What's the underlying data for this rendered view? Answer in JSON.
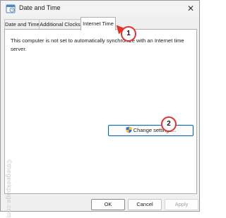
{
  "window": {
    "title": "Date and Time"
  },
  "tabs": [
    {
      "label": "Date and Time"
    },
    {
      "label": "Additional Clocks"
    },
    {
      "label": "Internet Time"
    }
  ],
  "panel": {
    "message": "This computer is not set to automatically synchronize with an Internet time server.",
    "change_button_label": "Change settings..."
  },
  "buttons": {
    "ok": "OK",
    "cancel": "Cancel",
    "apply": "Apply"
  },
  "annotations": {
    "step1": "1",
    "step2": "2"
  },
  "watermark": "©thegeekpage.com",
  "colors": {
    "annotation_red": "#e4332d",
    "accent_blue": "#0067c0"
  },
  "icons": {
    "app": "calendar-clock-icon",
    "change": "uac-shield-icon",
    "close": "close-icon"
  }
}
